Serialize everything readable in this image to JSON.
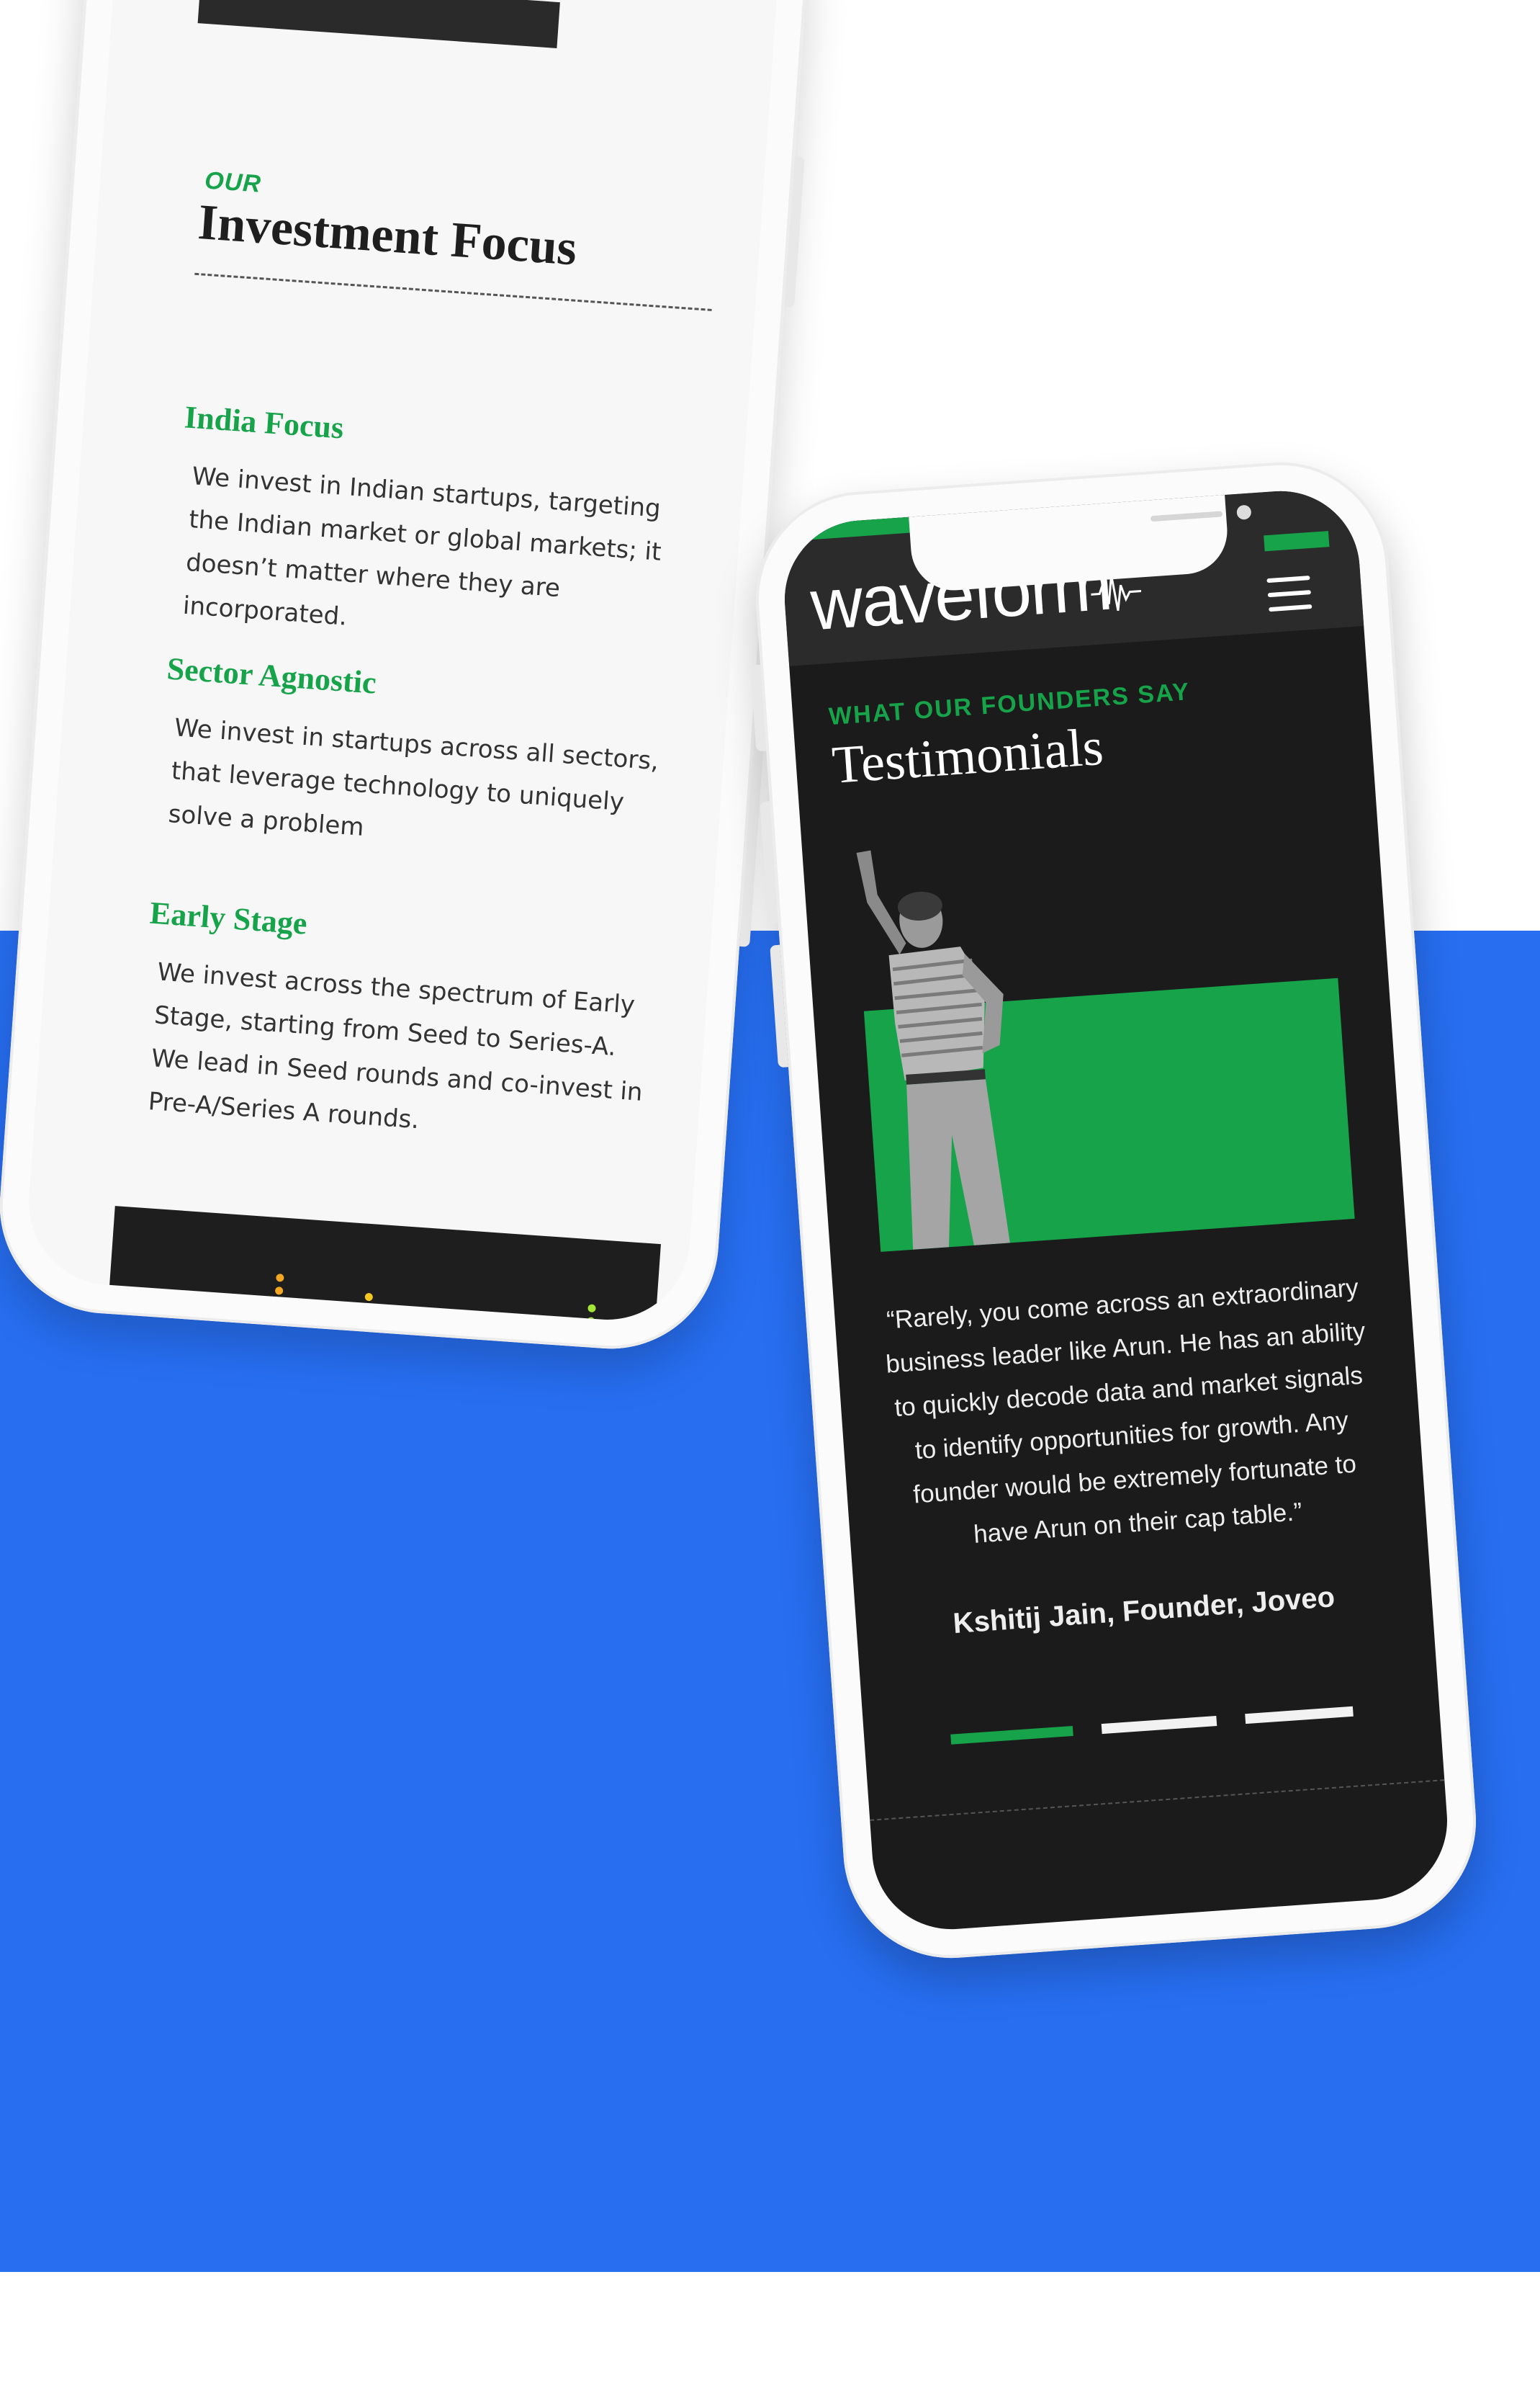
{
  "colors": {
    "background": "#ffffff",
    "band": "#276ef1",
    "accent_green": "#16a34a",
    "dark": "#1b1b1b",
    "light_screen": "#f7f7f7"
  },
  "investment_focus": {
    "eyebrow": "OUR",
    "title": "Investment Focus",
    "items": [
      {
        "heading": "India Focus",
        "body": "We invest in Indian startups, targeting the Indian market or global markets; it doesn’t matter where they are incorporated."
      },
      {
        "heading": "Sector Agnostic",
        "body": "We invest in startups across all sectors, that leverage technology to uniquely solve a problem"
      },
      {
        "heading": "Early Stage",
        "body": "We invest across the spectrum of Early Stage, starting from Seed to Series-A. We lead in Seed rounds and co-invest in Pre-A/Series A rounds."
      }
    ]
  },
  "testimonials": {
    "logo": "waveform",
    "logo_icon": "waveform-icon",
    "menu_icon": "hamburger-menu-icon",
    "eyebrow": "WHAT OUR FOUNDERS SAY",
    "title": "Testimonials",
    "quote": "“Rarely, you come across an extraordinary business leader like Arun. He has an ability to quickly decode data and market signals to identify opportunities for growth. Any founder would be extremely fortunate to have Arun on their cap table.”",
    "author": "Kshitij Jain, Founder, Joveo",
    "carousel_count": 3,
    "carousel_active_index": 0
  }
}
